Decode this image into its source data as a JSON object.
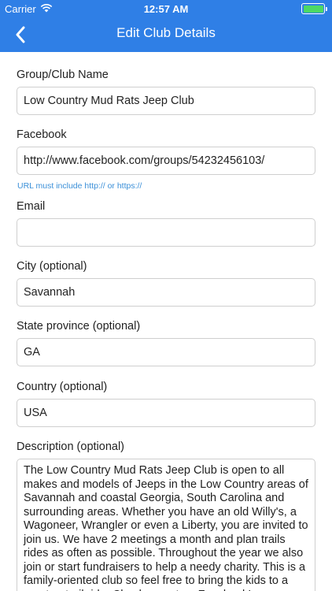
{
  "status_bar": {
    "carrier": "Carrier",
    "time": "12:57 AM"
  },
  "nav": {
    "title": "Edit Club Details",
    "back_icon": "chevron-left-icon"
  },
  "form": {
    "club_name": {
      "label": "Group/Club Name",
      "value": "Low Country Mud Rats Jeep Club"
    },
    "facebook": {
      "label": "Facebook",
      "value": "http://www.facebook.com/groups/54232456103/",
      "hint": "URL must include http:// or https://"
    },
    "email": {
      "label": "Email",
      "value": ""
    },
    "city": {
      "label": "City (optional)",
      "value": "Savannah"
    },
    "state": {
      "label": "State province (optional)",
      "value": "GA"
    },
    "country": {
      "label": "Country (optional)",
      "value": "USA"
    },
    "description": {
      "label": "Description (optional)",
      "value": "The Low Country Mud Rats Jeep Club is open to all makes and models of Jeeps in the Low Country areas of Savannah and coastal Georgia, South Carolina and surrounding areas. Whether you have an old Willy's, a Wagoneer, Wrangler or even a Liberty, you are invited to join us. We have 2 meetings a month and plan trails rides as often as possible. Throughout the year we also join or start fundraisers to help a needy charity. This is a family-oriented club so feel free to bring the kids to a meet or trail ride. Check us out on Facebook!"
    }
  },
  "colors": {
    "header": "#2f7fe6",
    "hint": "#3a8fd8",
    "battery": "#4cd964"
  }
}
